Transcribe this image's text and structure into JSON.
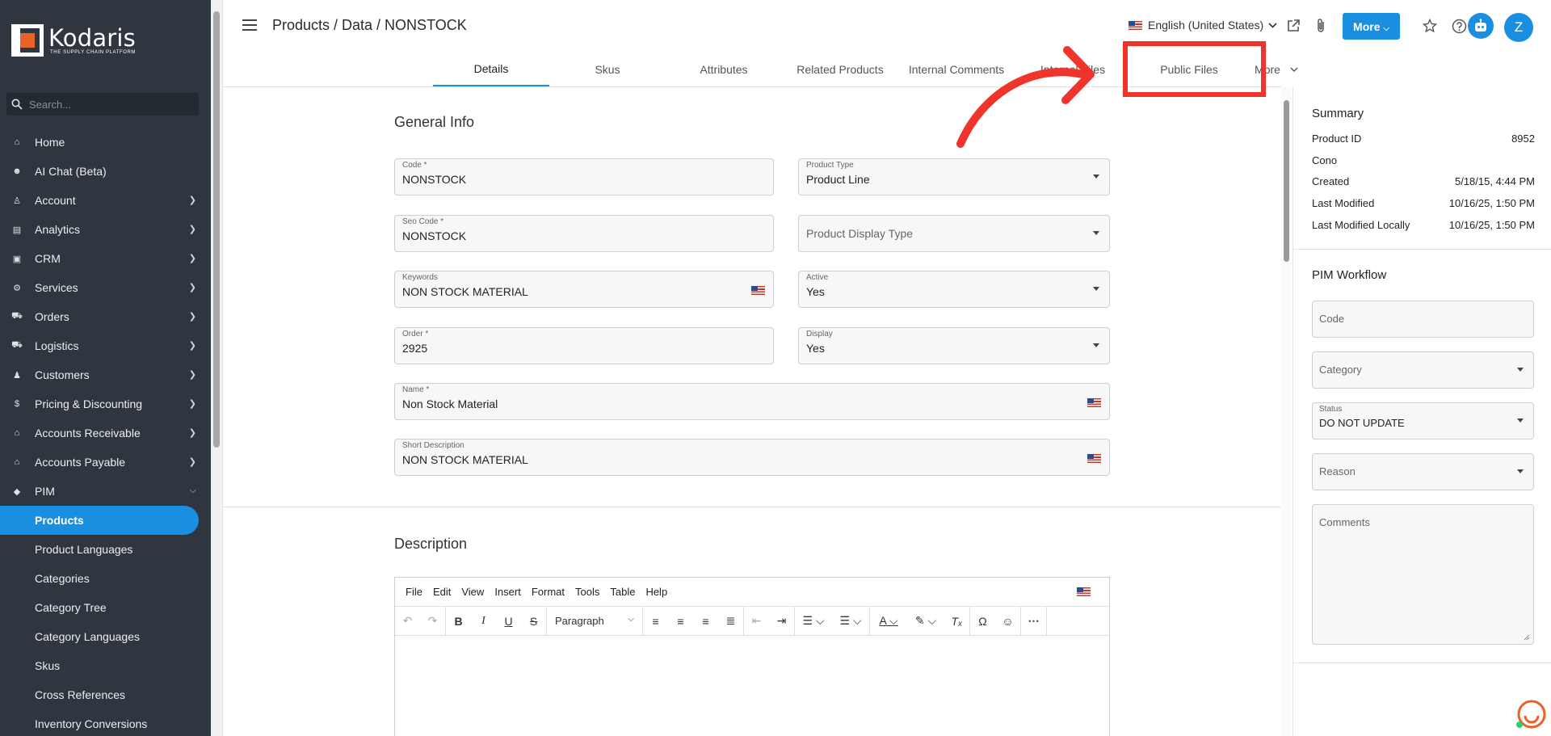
{
  "brand": {
    "name": "Kodaris",
    "tagline": "THE SUPPLY CHAIN PLATFORM"
  },
  "search": {
    "placeholder": "Search..."
  },
  "sidebar": {
    "items": [
      {
        "label": "Home",
        "icon": "home-icon",
        "glyph": "⌂"
      },
      {
        "label": "AI Chat (Beta)",
        "icon": "robot-icon",
        "glyph": "☻"
      },
      {
        "label": "Account",
        "icon": "user-icon",
        "glyph": "♙"
      },
      {
        "label": "Analytics",
        "icon": "chart-icon",
        "glyph": "▤"
      },
      {
        "label": "CRM",
        "icon": "contact-card-icon",
        "glyph": "▣"
      },
      {
        "label": "Services",
        "icon": "services-icon",
        "glyph": "⚙"
      },
      {
        "label": "Orders",
        "icon": "truck-icon",
        "glyph": "⛟"
      },
      {
        "label": "Logistics",
        "icon": "logistics-icon",
        "glyph": "⛟"
      },
      {
        "label": "Customers",
        "icon": "customers-icon",
        "glyph": "♟"
      },
      {
        "label": "Pricing & Discounting",
        "icon": "dollar-icon",
        "glyph": "$"
      },
      {
        "label": "Accounts Receivable",
        "icon": "bank-icon",
        "glyph": "⌂"
      },
      {
        "label": "Accounts Payable",
        "icon": "bank-icon",
        "glyph": "⌂"
      },
      {
        "label": "PIM",
        "icon": "tag-icon",
        "glyph": "◆"
      }
    ],
    "pim_subitems": [
      "Products",
      "Product Languages",
      "Categories",
      "Category Tree",
      "Category Languages",
      "Skus",
      "Cross References",
      "Inventory Conversions"
    ]
  },
  "header": {
    "breadcrumb": "Products / Data / NONSTOCK",
    "language": "English (United States)",
    "more_label": "More",
    "avatar_initial": "Z"
  },
  "tabs": [
    "Details",
    "Skus",
    "Attributes",
    "Related Products",
    "Internal Comments",
    "Internal Files",
    "Public Files",
    "More"
  ],
  "general_info": {
    "title": "General Info",
    "code": {
      "label": "Code *",
      "value": "NONSTOCK"
    },
    "product_type": {
      "label": "Product Type",
      "value": "Product Line"
    },
    "seo_code": {
      "label": "Seo Code *",
      "value": "NONSTOCK"
    },
    "product_display_type": {
      "placeholder": "Product Display Type"
    },
    "keywords": {
      "label": "Keywords",
      "value": "NON STOCK MATERIAL"
    },
    "active": {
      "label": "Active",
      "value": "Yes"
    },
    "order": {
      "label": "Order *",
      "value": "2925"
    },
    "display": {
      "label": "Display",
      "value": "Yes"
    },
    "name": {
      "label": "Name *",
      "value": "Non Stock Material"
    },
    "short_description": {
      "label": "Short Description",
      "value": "NON STOCK MATERIAL"
    }
  },
  "description": {
    "title": "Description",
    "menu": [
      "File",
      "Edit",
      "View",
      "Insert",
      "Format",
      "Tools",
      "Table",
      "Help"
    ],
    "block_format": "Paragraph"
  },
  "summary": {
    "title": "Summary",
    "rows": [
      {
        "key": "Product ID",
        "value": "8952"
      },
      {
        "key": "Cono",
        "value": ""
      },
      {
        "key": "Created",
        "value": "5/18/15, 4:44 PM"
      },
      {
        "key": "Last Modified",
        "value": "10/16/25, 1:50 PM"
      },
      {
        "key": "Last Modified Locally",
        "value": "10/16/25, 1:50 PM"
      }
    ]
  },
  "pim_workflow": {
    "title": "PIM Workflow",
    "code_placeholder": "Code",
    "category_placeholder": "Category",
    "status": {
      "label": "Status",
      "value": "DO NOT UPDATE"
    },
    "reason_placeholder": "Reason",
    "comments_placeholder": "Comments"
  },
  "colors": {
    "accent": "#1a8fe0",
    "sidebar": "#2f3640",
    "annotation": "#f0342b"
  }
}
